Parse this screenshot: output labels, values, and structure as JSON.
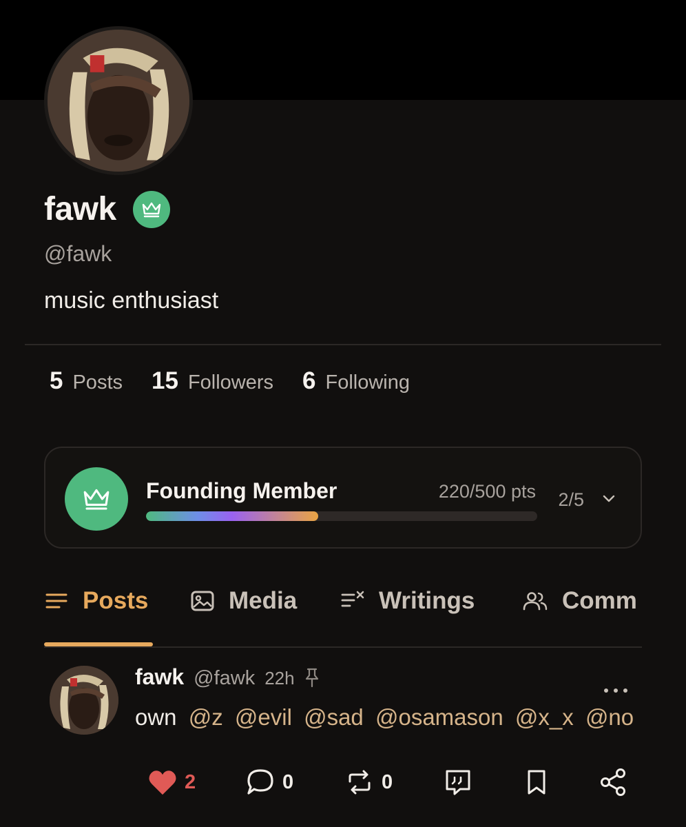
{
  "profile": {
    "display_name": "fawk",
    "handle": "@fawk",
    "bio": "music enthusiast",
    "badge_icon": "crown-icon",
    "badge_color": "#4fb97f"
  },
  "stats": [
    {
      "value": "5",
      "label": "Posts"
    },
    {
      "value": "15",
      "label": "Followers"
    },
    {
      "value": "6",
      "label": "Following"
    }
  ],
  "membership": {
    "title": "Founding Member",
    "points": "220/500 pts",
    "level": "2/5",
    "progress": 0.44,
    "icon": "crown-icon"
  },
  "tabs": [
    {
      "label": "Posts",
      "icon": "list-icon",
      "active": true
    },
    {
      "label": "Media",
      "icon": "image-icon",
      "active": false
    },
    {
      "label": "Writings",
      "icon": "writings-icon",
      "active": false
    },
    {
      "label": "Comm",
      "icon": "community-icon",
      "active": false
    }
  ],
  "post": {
    "author": "fawk",
    "handle": "@fawk",
    "time": "22h",
    "pinned": true,
    "text_prefix": "own",
    "mentions": [
      "@z",
      "@evil",
      "@sad",
      "@osamason",
      "@x_x",
      "@no"
    ],
    "actions": {
      "likes": "2",
      "comments": "0",
      "reposts": "0"
    }
  },
  "colors": {
    "accent": "#e7a95d",
    "background": "#110f0e",
    "like": "#e05a56",
    "mention": "#d6b48a"
  }
}
